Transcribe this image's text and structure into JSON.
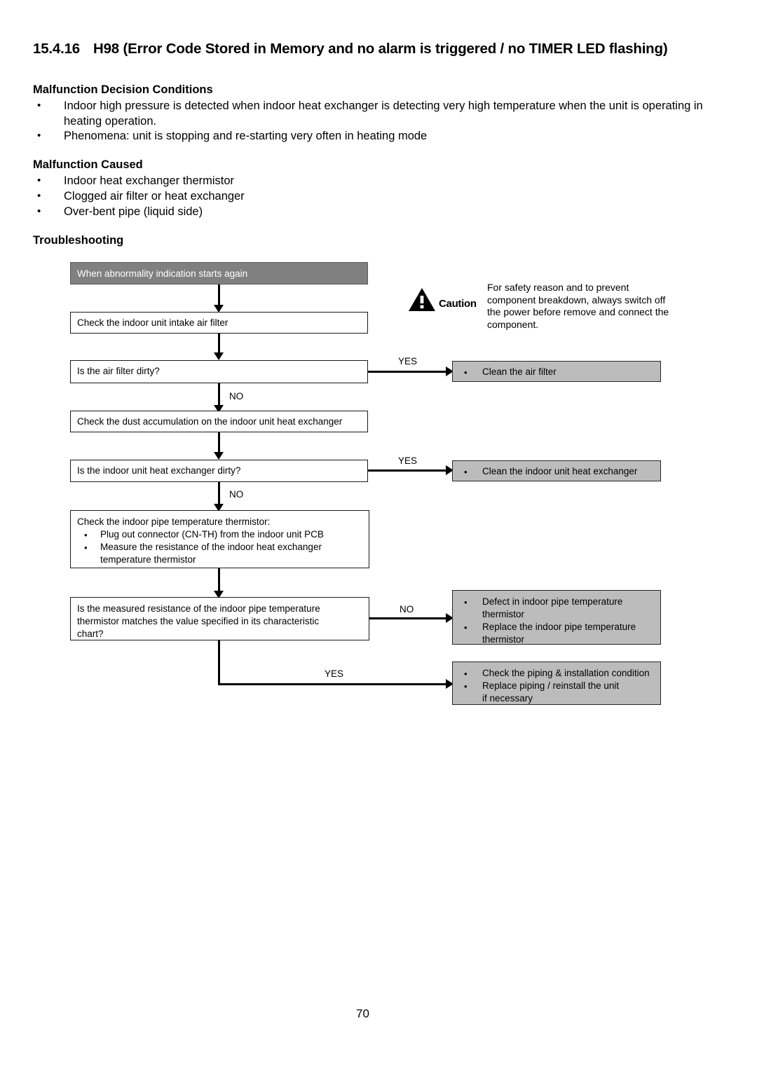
{
  "document": {
    "section_number": "15.4.16",
    "section_title": "H98 (Error Code Stored in Memory and no alarm is triggered / no TIMER LED flashing)",
    "page_number": "70"
  },
  "malfunction_decision_conditions": {
    "heading": "Malfunction Decision Conditions",
    "items": [
      "Indoor high pressure is detected when indoor heat exchanger is detecting very high temperature when the unit is operating in heating operation.",
      "Phenomena: unit is stopping and re-starting very often in heating mode"
    ]
  },
  "malfunction_caused": {
    "heading": "Malfunction Caused",
    "items": [
      "Indoor heat exchanger thermistor",
      "Clogged air filter or heat exchanger",
      "Over-bent pipe (liquid side)"
    ]
  },
  "troubleshooting": {
    "heading": "Troubleshooting",
    "caution": {
      "label": "Caution",
      "text": "For safety reason and to prevent component breakdown, always switch off the power before remove and connect the component."
    },
    "nodes": {
      "start": "When abnormality indication starts again",
      "step1": "Check the indoor unit intake air filter",
      "decision1": "Is the air filter dirty?",
      "step2": "Check the dust accumulation on the indoor unit heat exchanger",
      "decision2": "Is the indoor unit heat exchanger dirty?",
      "step3_title": "Check the indoor pipe temperature thermistor:",
      "step3_bullets": [
        "Plug out connector (CN-TH) from the indoor unit PCB",
        "Measure the resistance of the indoor heat exchanger",
        "temperature thermistor"
      ],
      "decision3_lines": [
        "Is the measured resistance of the indoor pipe temperature",
        "thermistor matches the value specified in its characteristic",
        "chart?"
      ]
    },
    "results": {
      "clean_air_filter": "Clean the air filter",
      "clean_heat_exchanger": "Clean the indoor unit heat exchanger",
      "thermistor_defect": [
        "Defect in indoor pipe temperature",
        "thermistor",
        "Replace the indoor pipe temperature",
        "thermistor"
      ],
      "piping": [
        "Check the piping & installation condition",
        "Replace piping / reinstall the unit",
        "if necessary"
      ]
    },
    "edge_labels": {
      "yes1": "YES",
      "no1": "NO",
      "yes2": "YES",
      "no2": "NO",
      "no3": "NO",
      "yes3": "YES"
    }
  },
  "colors": {
    "header_box": "#808080",
    "result_box": "#bcbcbc",
    "line": "#000000"
  }
}
